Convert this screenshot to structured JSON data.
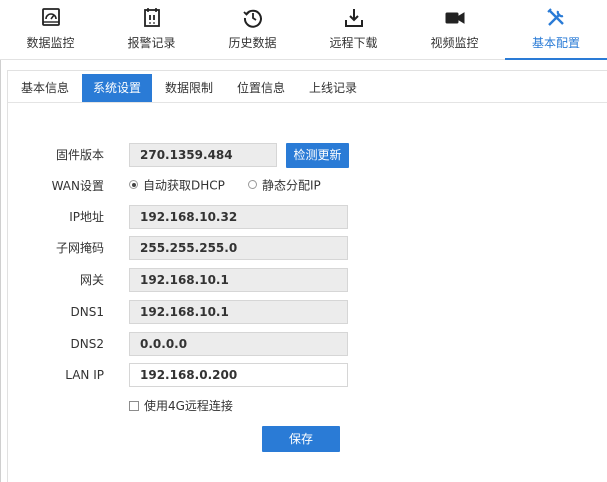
{
  "nav": {
    "items": [
      {
        "label": "数据监控",
        "icon": "gauge-icon"
      },
      {
        "label": "报警记录",
        "icon": "alarm-record-icon"
      },
      {
        "label": "历史数据",
        "icon": "history-icon"
      },
      {
        "label": "远程下载",
        "icon": "download-icon"
      },
      {
        "label": "视频监控",
        "icon": "video-camera-icon"
      },
      {
        "label": "基本配置",
        "icon": "tools-icon"
      }
    ],
    "active": "基本配置",
    "accent_color": "#2a7bd6"
  },
  "subtabs": {
    "items": [
      "基本信息",
      "系统设置",
      "数据限制",
      "位置信息",
      "上线记录"
    ],
    "active": "系统设置"
  },
  "form": {
    "firmware": {
      "label": "固件版本",
      "value": "270.1359.484",
      "check_update_label": "检测更新"
    },
    "wan": {
      "label": "WAN设置",
      "option_dhcp": "自动获取DHCP",
      "option_static": "静态分配IP",
      "selected": "自动获取DHCP"
    },
    "ip": {
      "label": "IP地址",
      "value": "192.168.10.32"
    },
    "subnet": {
      "label": "子网掩码",
      "value": "255.255.255.0"
    },
    "gateway": {
      "label": "网关",
      "value": "192.168.10.1"
    },
    "dns1": {
      "label": "DNS1",
      "value": "192.168.10.1"
    },
    "dns2": {
      "label": "DNS2",
      "value": "0.0.0.0"
    },
    "lan": {
      "label": "LAN IP",
      "value": "192.168.0.200"
    },
    "use_4g": {
      "label": "使用4G远程连接",
      "checked": false
    },
    "save_label": "保存"
  }
}
